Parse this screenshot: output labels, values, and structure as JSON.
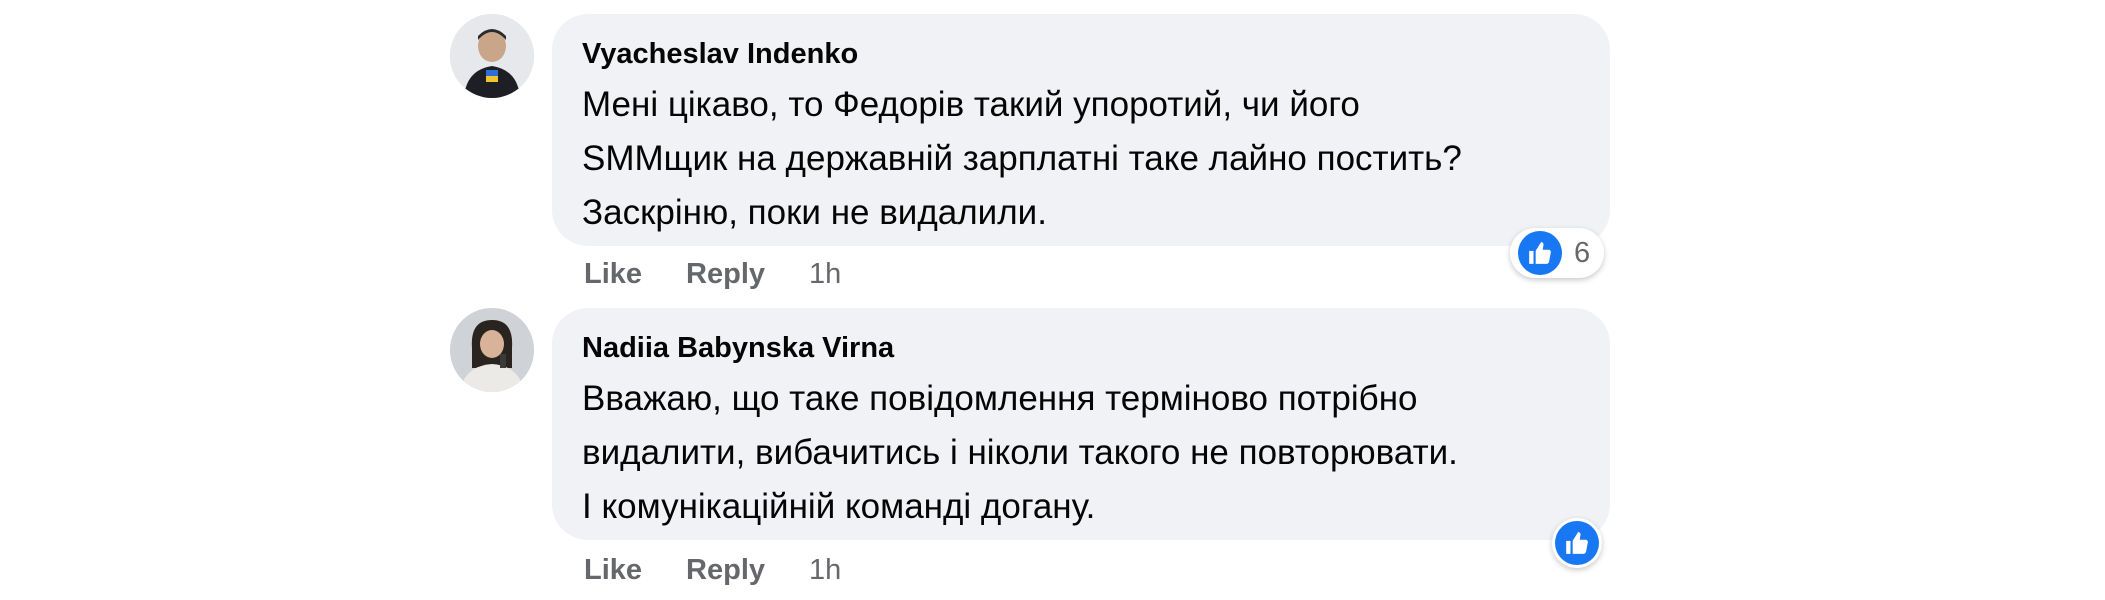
{
  "colors": {
    "bubble_bg": "#f0f2f5",
    "meta_text": "#65676b",
    "like_blue": "#1877f2"
  },
  "comments": [
    {
      "author": "Vyacheslav Indenko",
      "avatar_icon": "avatar-man-photo",
      "lines": [
        "Мені цікаво, то Федорів такий упоротий, чи його",
        "SMMщик на державній зарплатні таке лайно постить?",
        "Заскріню, поки не видалили."
      ],
      "like_label": "Like",
      "reply_label": "Reply",
      "time": "1h",
      "reaction_icon": "thumbs-up-icon",
      "reaction_count": "6"
    },
    {
      "author": "Nadiia Babynska Virna",
      "avatar_icon": "avatar-woman-photo",
      "lines": [
        "Вважаю, що таке повідомлення терміново потрібно",
        "видалити, вибачитись і ніколи такого не повторювати.",
        "І комунікаційній команді догану."
      ],
      "like_label": "Like",
      "reply_label": "Reply",
      "time": "1h",
      "reaction_icon": "thumbs-up-icon"
    }
  ]
}
